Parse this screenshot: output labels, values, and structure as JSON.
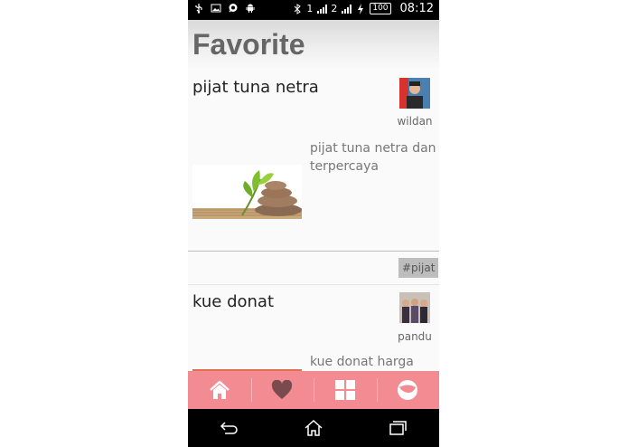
{
  "status_bar": {
    "battery": "100",
    "time": "08:12",
    "sim1": "1",
    "sim2": "2"
  },
  "header": {
    "title": "Favorite"
  },
  "posts": [
    {
      "title": "pijat tuna netra",
      "username": "wildan",
      "description": "pijat tuna netra dan terpercaya",
      "tag": "#pijat"
    },
    {
      "title": "kue donat",
      "username": "pandu",
      "description": "kue donat harga"
    }
  ],
  "tabs": [
    {
      "icon": "home-icon"
    },
    {
      "icon": "heart-icon"
    },
    {
      "icon": "grid-icon"
    },
    {
      "icon": "profile-circle-icon"
    }
  ],
  "nav": [
    {
      "icon": "back-icon"
    },
    {
      "icon": "home-nav-icon"
    },
    {
      "icon": "recent-apps-icon"
    }
  ],
  "colors": {
    "tabbar": "#f28c92",
    "header_text": "#666666",
    "tag_bg": "#bdbdbd"
  }
}
